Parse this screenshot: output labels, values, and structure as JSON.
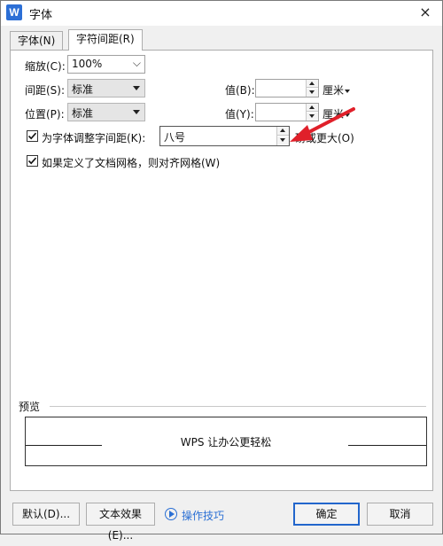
{
  "window": {
    "title": "字体",
    "app_icon": "W",
    "close_icon": "×"
  },
  "tabs": [
    {
      "label": "字体(N)",
      "active": false
    },
    {
      "label": "字符间距(R)",
      "active": true
    }
  ],
  "spacing": {
    "scale": {
      "label": "缩放(C):",
      "value": "100%"
    },
    "spacing": {
      "label": "间距(S):",
      "value": "标准"
    },
    "position": {
      "label": "位置(P):",
      "value": "标准"
    },
    "spacing_value": {
      "label": "值(B):",
      "value": "",
      "unit": "厘米"
    },
    "position_value": {
      "label": "值(Y):",
      "value": "",
      "unit": "厘米"
    },
    "kerning": {
      "label": "为字体调整字间距(K):",
      "value": "八号",
      "suffix": "磅或更大(O)",
      "checked": true
    },
    "grid": {
      "label": "如果定义了文档网格，则对齐网格(W)",
      "checked": true
    }
  },
  "preview": {
    "title": "预览",
    "sample_text": "WPS 让办公更轻松"
  },
  "buttons": {
    "default": "默认(D)...",
    "text_effects": "文本效果(E)...",
    "tips": "操作技巧",
    "ok": "确定",
    "cancel": "取消"
  },
  "colors": {
    "accent": "#2266cc",
    "link": "#2a6fd4",
    "annotation_arrow": "#e0202a"
  }
}
